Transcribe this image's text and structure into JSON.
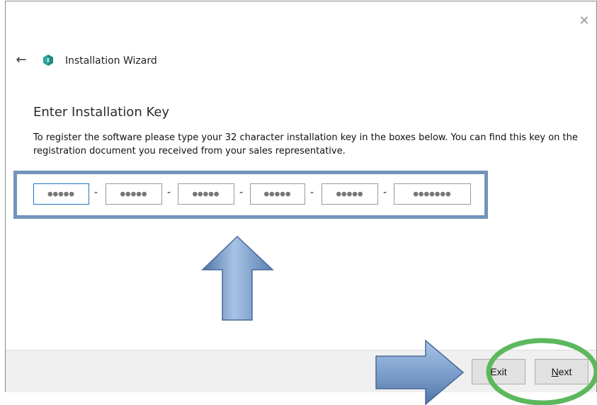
{
  "window": {
    "title": "Installation Wizard",
    "close_glyph": "✕",
    "back_glyph": "←",
    "app_icon": "shield-app-icon"
  },
  "content": {
    "heading": "Enter Installation Key",
    "description": "To register the software please type your 32 character installation key in the boxes below. You can find this key on the registration document you received from your sales representative.",
    "key_fields": [
      {
        "value": "●●●●●"
      },
      {
        "value": "●●●●●"
      },
      {
        "value": "●●●●●"
      },
      {
        "value": "●●●●●"
      },
      {
        "value": "●●●●●"
      },
      {
        "value": "●●●●●●●"
      }
    ],
    "separator": "-"
  },
  "footer": {
    "exit_label": "Exit",
    "next_label_first": "N",
    "next_label_rest": "ext"
  },
  "colors": {
    "annotation_blue": "#7393bb",
    "annotation_green": "#5cb85c",
    "focus_blue": "#1f73c9"
  }
}
